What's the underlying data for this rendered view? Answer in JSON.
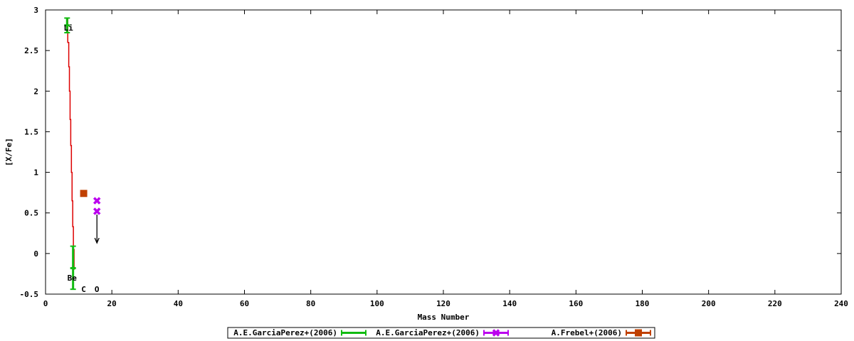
{
  "chart_data": {
    "type": "scatter",
    "xlabel": "Mass Number",
    "ylabel": "[X/Fe]",
    "xlim": [
      0,
      240
    ],
    "ylim": [
      -0.5,
      3
    ],
    "x_ticks": [
      0,
      20,
      40,
      60,
      80,
      100,
      120,
      140,
      160,
      180,
      200,
      220,
      240
    ],
    "y_ticks": [
      {
        "value": -0.5,
        "label": "-0.5"
      },
      {
        "value": 0,
        "label": "0"
      },
      {
        "value": 0.5,
        "label": "0.5"
      },
      {
        "value": 1,
        "label": "1"
      },
      {
        "value": 1.5,
        "label": "1.5"
      },
      {
        "value": 2,
        "label": "2"
      },
      {
        "value": 2.5,
        "label": "2.5"
      },
      {
        "value": 3,
        "label": "3"
      }
    ],
    "grid": false,
    "legend_position": "bottom",
    "model_line": {
      "color": "#dd0000",
      "x": [
        6.3,
        6.7,
        7.0,
        7.2,
        7.4,
        7.6,
        7.8,
        8.0,
        8.2,
        8.4,
        8.6
      ],
      "y": [
        2.9,
        2.6,
        2.3,
        2.0,
        1.65,
        1.33,
        1.0,
        0.65,
        0.33,
        0.05,
        -0.2
      ]
    },
    "series": [
      {
        "name": "A.E.GarciaPerez+(2006)",
        "color": "#11bb11",
        "marker": "bar",
        "points": [
          {
            "x": 6.5,
            "y": 2.81,
            "ylow": 2.72,
            "yhigh": 2.9
          },
          {
            "x": 8.3,
            "y": -0.18,
            "ylow": -0.44,
            "yhigh": 0.09
          }
        ]
      },
      {
        "name": "A.E.GarciaPerez+(2006)",
        "color": "#bb00ee",
        "marker": "cross",
        "points": [
          {
            "x": 15.5,
            "y": 0.65
          },
          {
            "x": 15.5,
            "y": 0.52
          }
        ]
      },
      {
        "name": "A.Frebel+(2006)",
        "color": "#c04000",
        "marker": "square",
        "points": [
          {
            "x": 11.5,
            "y": 0.74
          }
        ]
      }
    ],
    "upper_limit_arrow": {
      "x": 15.5,
      "y_from": 0.48,
      "y_to": 0.13,
      "color": "#000000"
    },
    "element_labels": [
      {
        "text": "Li",
        "x": 6.9,
        "y": 2.78
      },
      {
        "text": "Be",
        "x": 8.0,
        "y": -0.3
      },
      {
        "text": "C",
        "x": 11.5,
        "y": -0.44
      },
      {
        "text": "O",
        "x": 15.5,
        "y": -0.44
      }
    ]
  }
}
